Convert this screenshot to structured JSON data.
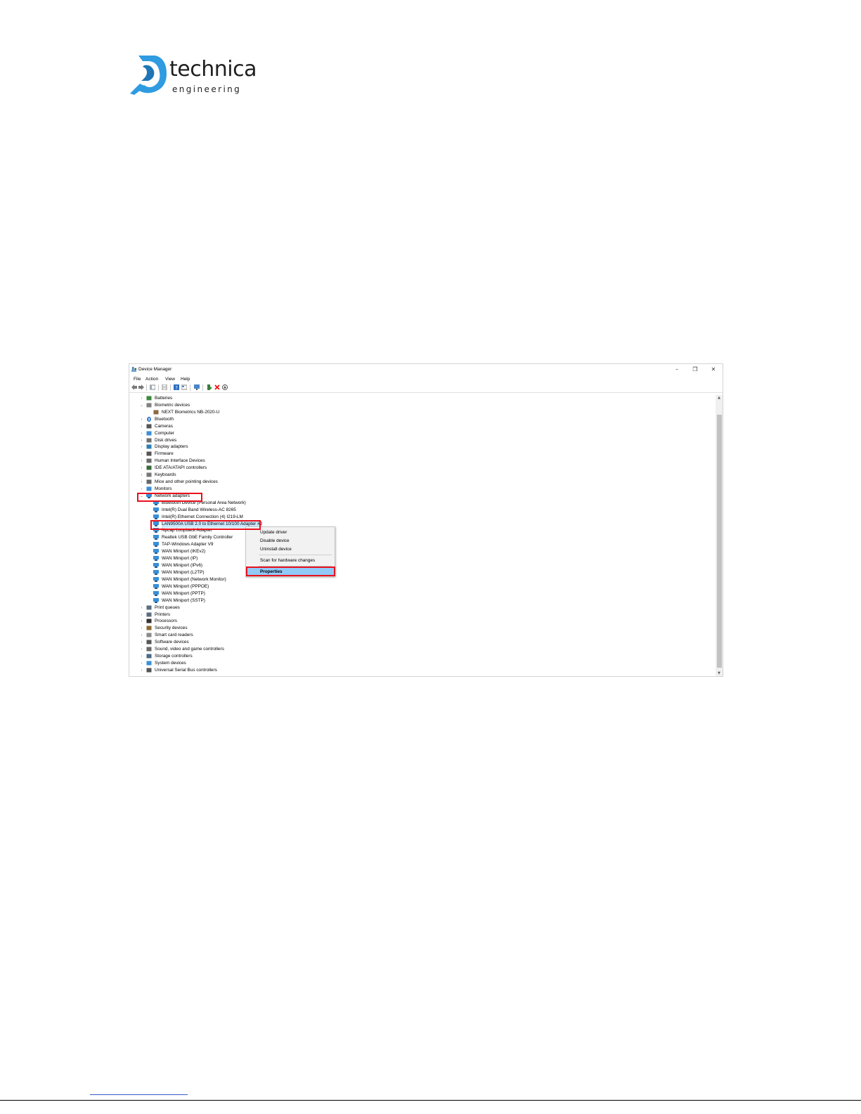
{
  "logo": {
    "word": "technica",
    "sub": "engineering",
    "brand_color": "#2f9be0"
  },
  "window": {
    "title": "Device Manager",
    "controls": {
      "minimize": "–",
      "restore": "❐",
      "close": "✕"
    },
    "menu": [
      "File",
      "Action",
      "View",
      "Help"
    ]
  },
  "tree": {
    "items": [
      {
        "label": "Batteries",
        "icon": "battery-icon"
      },
      {
        "label": "Biometric devices",
        "icon": "biometric-icon",
        "expanded": true
      },
      {
        "label": "NEXT Biometrics NB-2020-U",
        "icon": "fingerprint-icon"
      },
      {
        "label": "Bluetooth",
        "icon": "bluetooth-icon"
      },
      {
        "label": "Cameras",
        "icon": "camera-icon"
      },
      {
        "label": "Computer",
        "icon": "computer-icon"
      },
      {
        "label": "Disk drives",
        "icon": "disk-icon"
      },
      {
        "label": "Display adapters",
        "icon": "display-icon"
      },
      {
        "label": "Firmware",
        "icon": "firmware-icon"
      },
      {
        "label": "Human Interface Devices",
        "icon": "hid-icon"
      },
      {
        "label": "IDE ATA/ATAPI controllers",
        "icon": "ide-icon"
      },
      {
        "label": "Keyboards",
        "icon": "keyboard-icon"
      },
      {
        "label": "Mice and other pointing devices",
        "icon": "mouse-icon"
      },
      {
        "label": "Monitors",
        "icon": "monitor-icon"
      },
      {
        "label": "Network adapters",
        "icon": "network-icon",
        "expanded": true
      },
      {
        "label": "Bluetooth Device (Personal Area Network)",
        "icon": "network-icon"
      },
      {
        "label": "Intel(R) Dual Band Wireless-AC 8265",
        "icon": "network-icon"
      },
      {
        "label": "Intel(R) Ethernet Connection (4) I219-LM",
        "icon": "network-icon"
      },
      {
        "label": "LAN9500A USB 2.0 to Ethernet 10/100 Adapter #2",
        "icon": "network-icon",
        "selected": true
      },
      {
        "label": "Npcap Loopback Adapter",
        "icon": "network-icon"
      },
      {
        "label": "Realtek USB GbE Family Controller",
        "icon": "network-icon"
      },
      {
        "label": "TAP-Windows Adapter V9",
        "icon": "network-icon"
      },
      {
        "label": "WAN Miniport (IKEv2)",
        "icon": "network-icon"
      },
      {
        "label": "WAN Miniport (IP)",
        "icon": "network-icon"
      },
      {
        "label": "WAN Miniport (IPv6)",
        "icon": "network-icon"
      },
      {
        "label": "WAN Miniport (L2TP)",
        "icon": "network-icon"
      },
      {
        "label": "WAN Miniport (Network Monitor)",
        "icon": "network-icon"
      },
      {
        "label": "WAN Miniport (PPPOE)",
        "icon": "network-icon"
      },
      {
        "label": "WAN Miniport (PPTP)",
        "icon": "network-icon"
      },
      {
        "label": "WAN Miniport (SSTP)",
        "icon": "network-icon"
      },
      {
        "label": "Print queues",
        "icon": "printer-icon"
      },
      {
        "label": "Printers",
        "icon": "printer-icon"
      },
      {
        "label": "Processors",
        "icon": "processor-icon"
      },
      {
        "label": "Security devices",
        "icon": "security-icon"
      },
      {
        "label": "Smart card readers",
        "icon": "smartcard-icon"
      },
      {
        "label": "Software devices",
        "icon": "software-icon"
      },
      {
        "label": "Sound, video and game controllers",
        "icon": "sound-icon"
      },
      {
        "label": "Storage controllers",
        "icon": "storage-icon"
      },
      {
        "label": "System devices",
        "icon": "system-icon"
      },
      {
        "label": "Universal Serial Bus controllers",
        "icon": "usb-icon"
      }
    ]
  },
  "context_menu": {
    "update": "Update driver",
    "disable": "Disable device",
    "uninstall": "Uninstall device",
    "scan": "Scan for hardware changes",
    "properties": "Properties"
  },
  "colors": {
    "highlight": "#e8111b",
    "selection": "#cce8ff",
    "menu_highlight": "#91c9f7"
  }
}
